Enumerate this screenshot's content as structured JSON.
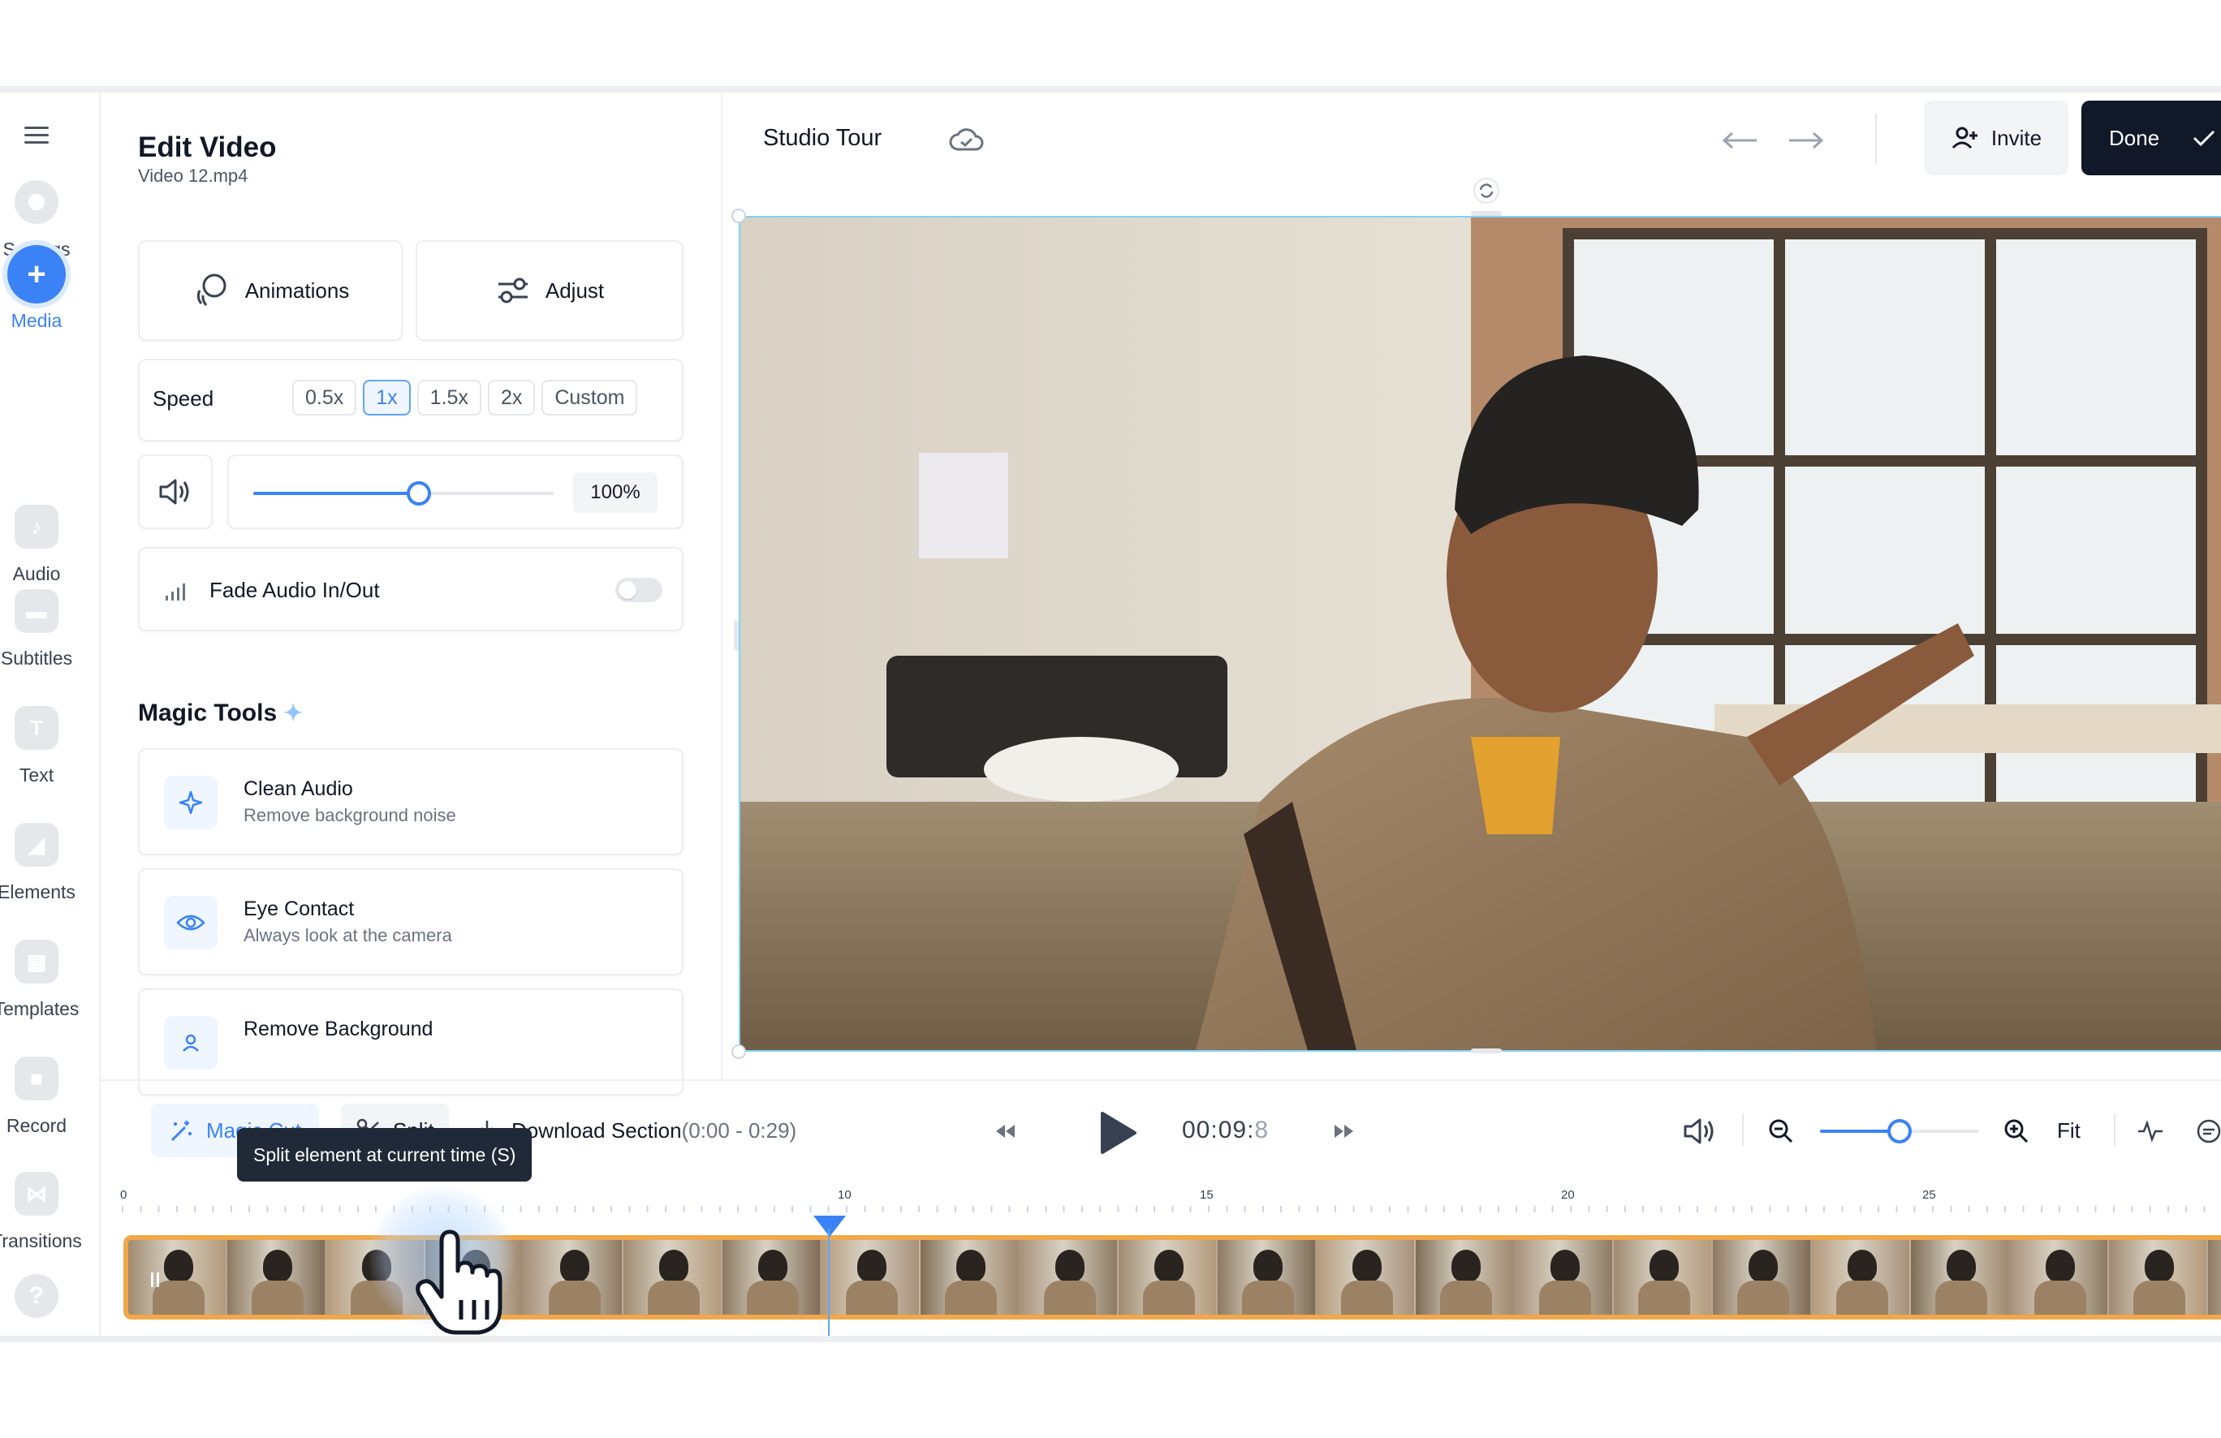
{
  "sidebar": {
    "items": [
      {
        "label": "Settings",
        "icon": "settings-icon"
      },
      {
        "label": "Media",
        "icon": "plus-icon",
        "active": true
      },
      {
        "label": "Audio",
        "icon": "music-note-icon"
      },
      {
        "label": "Subtitles",
        "icon": "subtitles-icon"
      },
      {
        "label": "Text",
        "icon": "text-icon"
      },
      {
        "label": "Elements",
        "icon": "elements-icon"
      },
      {
        "label": "Templates",
        "icon": "templates-icon"
      },
      {
        "label": "Record",
        "icon": "camera-icon"
      },
      {
        "label": "Transitions",
        "icon": "transitions-icon"
      }
    ],
    "help_icon": "help-icon"
  },
  "panel": {
    "title": "Edit Video",
    "subtitle": "Video 12.mp4",
    "animations_label": "Animations",
    "adjust_label": "Adjust",
    "speed_label": "Speed",
    "speed_options": [
      "0.5x",
      "1x",
      "1.5x",
      "2x",
      "Custom"
    ],
    "speed_selected": "1x",
    "volume_value": "100%",
    "volume_level": 0.55,
    "fade_label": "Fade Audio In/Out",
    "fade_on": false,
    "magic_tools_title": "Magic Tools",
    "tools": [
      {
        "title": "Clean Audio",
        "desc": "Remove background noise",
        "icon": "sparkle-icon"
      },
      {
        "title": "Eye Contact",
        "desc": "Always look at the camera",
        "icon": "eye-icon"
      },
      {
        "title": "Remove Background",
        "desc": "",
        "icon": "person-icon"
      }
    ]
  },
  "header": {
    "project_title": "Studio Tour",
    "invite_label": "Invite",
    "done_label": "Done"
  },
  "toolbar": {
    "magic_cut_label": "Magic Cut",
    "split_label": "Split",
    "download_label": "Download Section",
    "download_range": "(0:00 - 0:29)",
    "timecode": "00:09:",
    "timecode_frame": "8",
    "zoom_level": 0.5,
    "fit_label": "Fit",
    "tooltip": "Split element at current time (S)"
  },
  "timeline": {
    "tick_labels": [
      "0",
      "10",
      "15",
      "20",
      "25"
    ],
    "playhead_seconds": 9.8
  },
  "colors": {
    "accent": "#3b82f6",
    "clip_border": "#f0a84a",
    "dark_button": "#111827"
  }
}
